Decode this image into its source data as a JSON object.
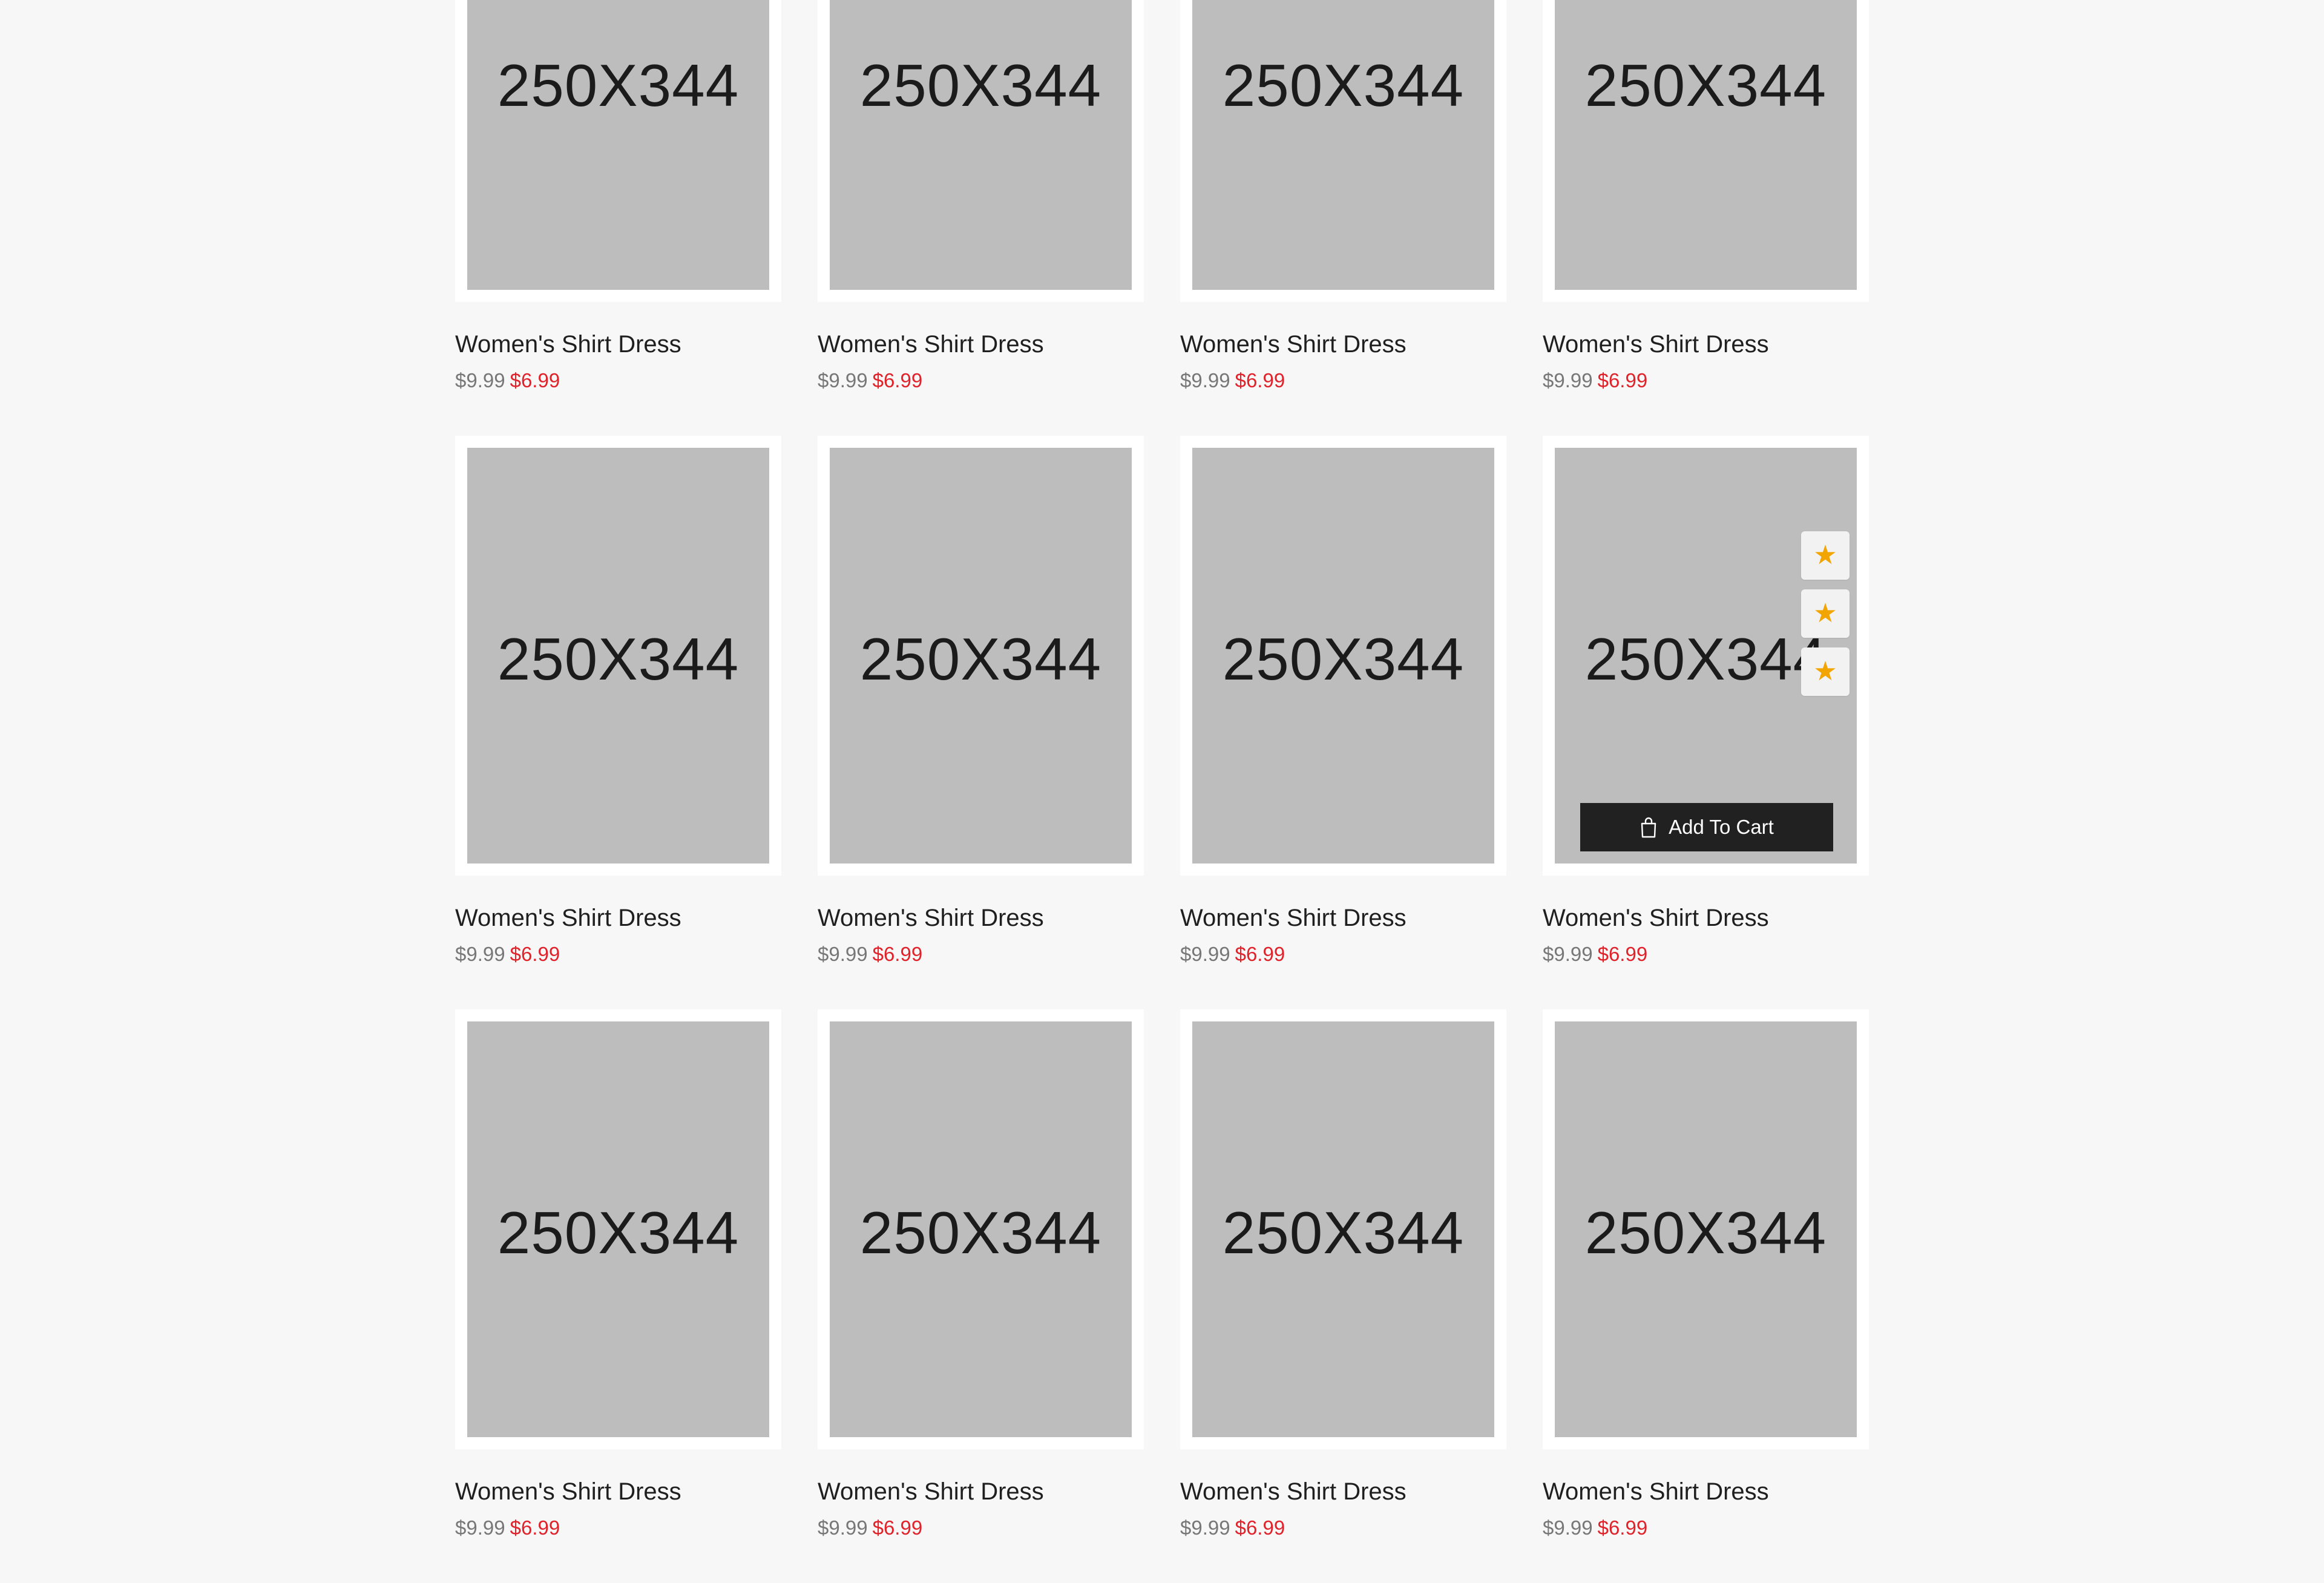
{
  "products": [
    {
      "image_label": "250X344",
      "title": "Women's Shirt Dress",
      "old_price": "$9.99",
      "new_price": "$6.99"
    },
    {
      "image_label": "250X344",
      "title": "Women's Shirt Dress",
      "old_price": "$9.99",
      "new_price": "$6.99"
    },
    {
      "image_label": "250X344",
      "title": "Women's Shirt Dress",
      "old_price": "$9.99",
      "new_price": "$6.99"
    },
    {
      "image_label": "250X344",
      "title": "Women's Shirt Dress",
      "old_price": "$9.99",
      "new_price": "$6.99"
    },
    {
      "image_label": "250X344",
      "title": "Women's Shirt Dress",
      "old_price": "$9.99",
      "new_price": "$6.99"
    },
    {
      "image_label": "250X344",
      "title": "Women's Shirt Dress",
      "old_price": "$9.99",
      "new_price": "$6.99"
    },
    {
      "image_label": "250X344",
      "title": "Women's Shirt Dress",
      "old_price": "$9.99",
      "new_price": "$6.99"
    },
    {
      "image_label": "250X344",
      "title": "Women's Shirt Dress",
      "old_price": "$9.99",
      "new_price": "$6.99"
    },
    {
      "image_label": "250X344",
      "title": "Women's Shirt Dress",
      "old_price": "$9.99",
      "new_price": "$6.99"
    },
    {
      "image_label": "250X344",
      "title": "Women's Shirt Dress",
      "old_price": "$9.99",
      "new_price": "$6.99"
    },
    {
      "image_label": "250X344",
      "title": "Women's Shirt Dress",
      "old_price": "$9.99",
      "new_price": "$6.99"
    },
    {
      "image_label": "250X344",
      "title": "Women's Shirt Dress",
      "old_price": "$9.99",
      "new_price": "$6.99"
    }
  ],
  "hovered_card": {
    "add_to_cart_label": "Add To Cart",
    "cart_icon": "shopping-bag-icon",
    "action_icons": [
      "star-icon",
      "star-icon",
      "star-icon"
    ],
    "star_glyph": "★"
  },
  "colors": {
    "page_background": "#f7f7f7",
    "card_background": "#ffffff",
    "placeholder": "#bdbdbd",
    "old_price": "#777777",
    "sale_price": "#e0222a",
    "star": "#f2a400",
    "cart_button": "#212121"
  }
}
